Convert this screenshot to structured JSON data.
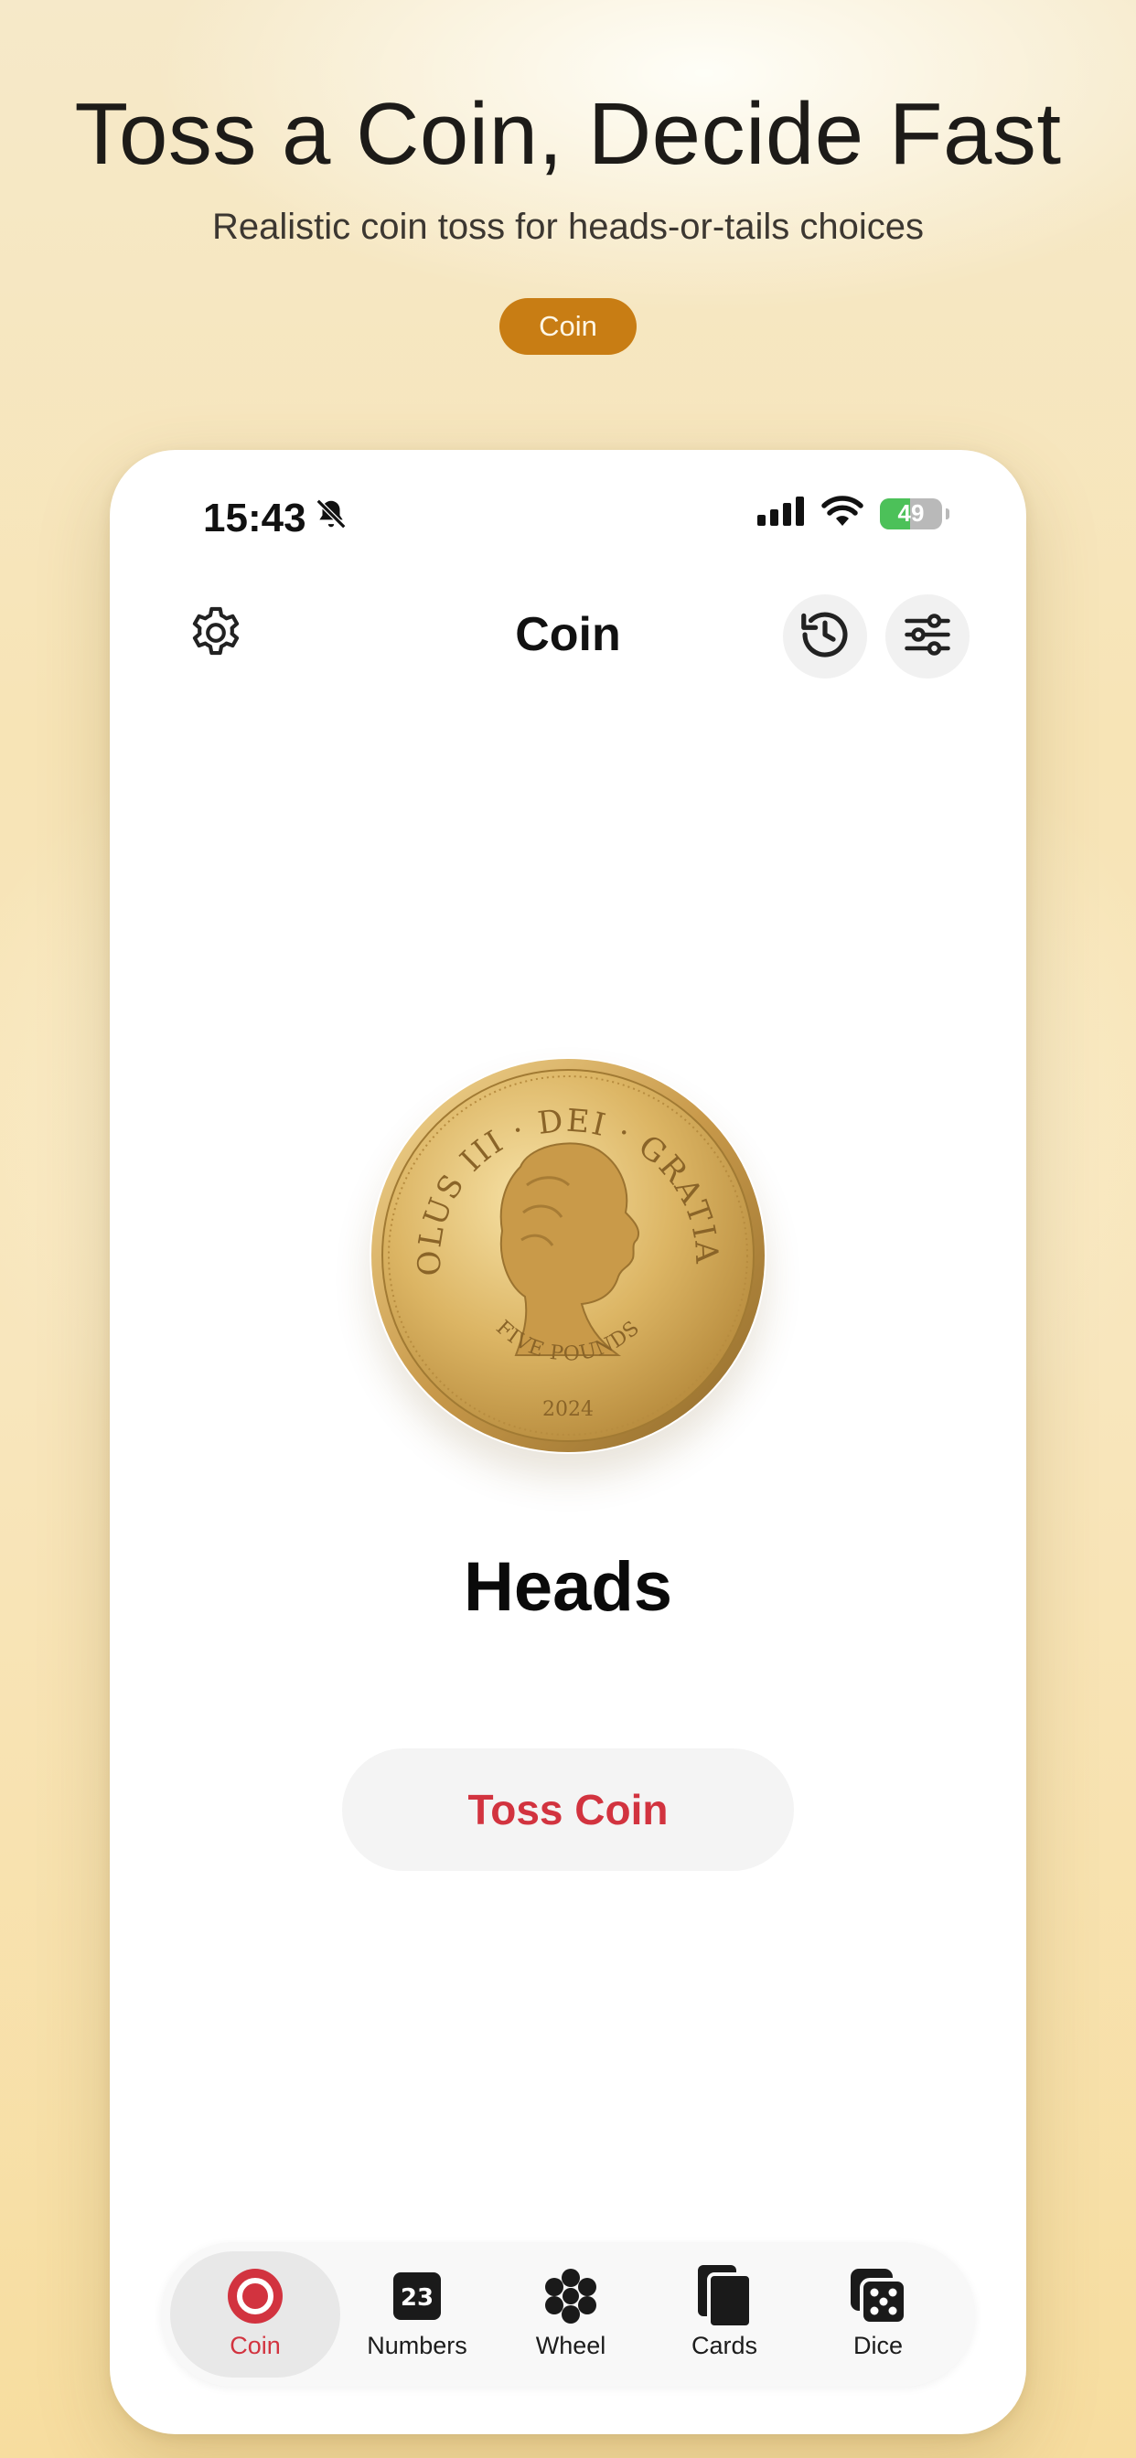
{
  "hero": {
    "title": "Toss a Coin, Decide Fast",
    "subtitle": "Realistic coin toss for heads-or-tails choices",
    "pill": "Coin"
  },
  "status_bar": {
    "time": "15:43",
    "battery": "49",
    "battery_level": 0.49,
    "icons": [
      "bell-slash-icon",
      "cellular-signal-icon",
      "wifi-icon",
      "battery-charging-icon"
    ]
  },
  "nav": {
    "title": "Coin",
    "left_icon": "gear-icon",
    "right_icons": [
      "history-icon",
      "sliders-icon"
    ]
  },
  "coin": {
    "legend": "CAROLUS III · DEI · GRATIA REX",
    "denomination": "FIVE POUNDS",
    "year": "2024"
  },
  "result": "Heads",
  "toss_button": "Toss Coin",
  "tabs": [
    {
      "label": "Coin",
      "icon": "coin-icon",
      "active": true
    },
    {
      "label": "Numbers",
      "icon": "numbers-icon",
      "badge": "23",
      "active": false
    },
    {
      "label": "Wheel",
      "icon": "wheel-icon",
      "active": false
    },
    {
      "label": "Cards",
      "icon": "cards-icon",
      "active": false
    },
    {
      "label": "Dice",
      "icon": "dice-icon",
      "active": false
    }
  ],
  "colors": {
    "accent_red": "#d2333f",
    "pill_gold": "#c87d14",
    "battery_green": "#4cc159"
  }
}
